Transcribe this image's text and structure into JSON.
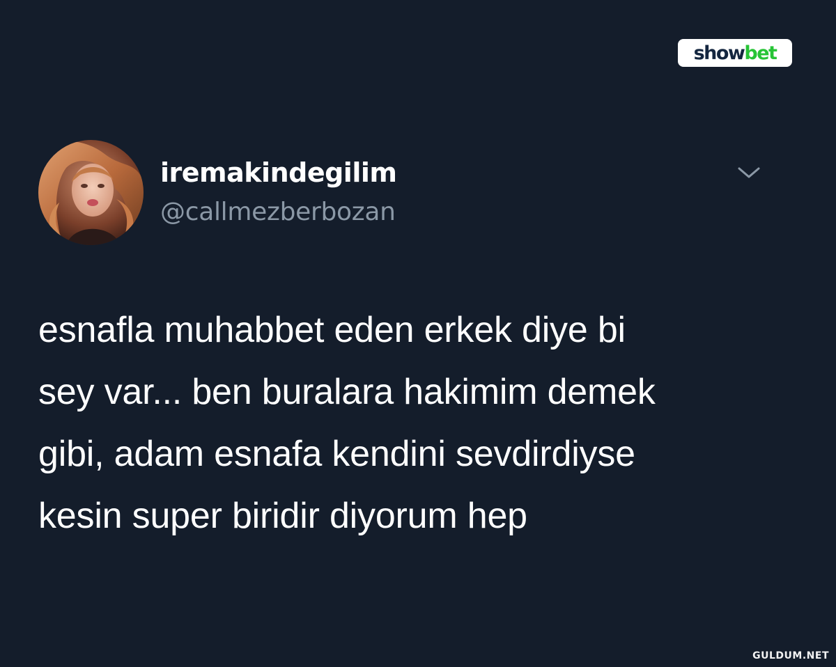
{
  "brand": {
    "part1": "show",
    "part2": "bet",
    "color_part1": "#14263f",
    "color_part2": "#27c436"
  },
  "tweet": {
    "display_name": "iremakindegilim",
    "handle": "@callmezberbozan",
    "menu_icon": "chevron-down-icon",
    "text_lines": [
      "esnafla muhabbet eden erkek diye bi",
      "sey var... ben buralara hakimim demek",
      "gibi, adam esnafa kendini sevdirdiyse",
      "kesin super biridir diyorum hep"
    ]
  },
  "watermark": "GULDUM.NET",
  "colors": {
    "background": "#141d2b",
    "text": "#ffffff",
    "handle": "#8b98a6"
  }
}
